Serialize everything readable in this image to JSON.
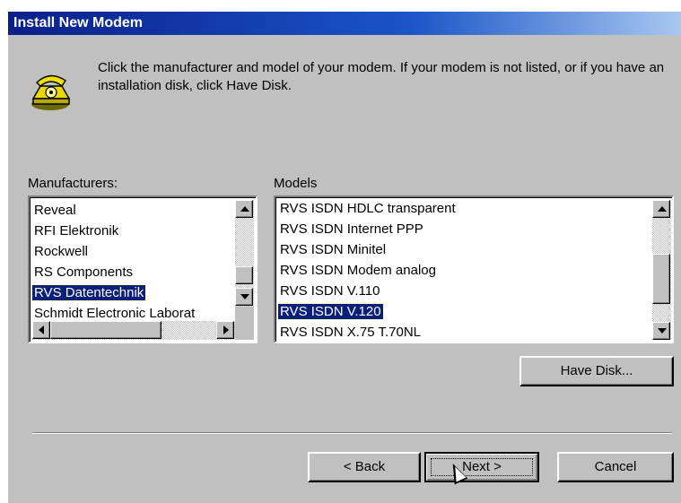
{
  "window": {
    "title": "Install New Modem"
  },
  "icon": "modem-telephone-icon",
  "description": "Click the manufacturer and model of your modem. If your modem is not listed, or if you have an installation disk, click Have Disk.",
  "manufacturers": {
    "label": "Manufacturers:",
    "items": [
      "Reveal",
      "RFI Elektronik",
      "Rockwell",
      "RS Components",
      "RVS Datentechnik",
      "Schmidt Electronic Laborat"
    ],
    "selected": "RVS Datentechnik"
  },
  "models": {
    "label": "Models",
    "items": [
      "RVS ISDN HDLC transparent",
      "RVS ISDN Internet PPP",
      "RVS ISDN Minitel",
      "RVS ISDN Modem analog",
      "RVS ISDN V.110",
      "RVS ISDN V.120",
      "RVS ISDN X.75 T.70NL"
    ],
    "selected": "RVS ISDN V.120"
  },
  "buttons": {
    "have_disk": "Have Disk...",
    "back": "< Back",
    "next": "Next >",
    "cancel": "Cancel"
  },
  "colors": {
    "selection": "#0a1f7a",
    "titlebar_start": "#0a1f8a",
    "face": "#c0c0c0"
  }
}
